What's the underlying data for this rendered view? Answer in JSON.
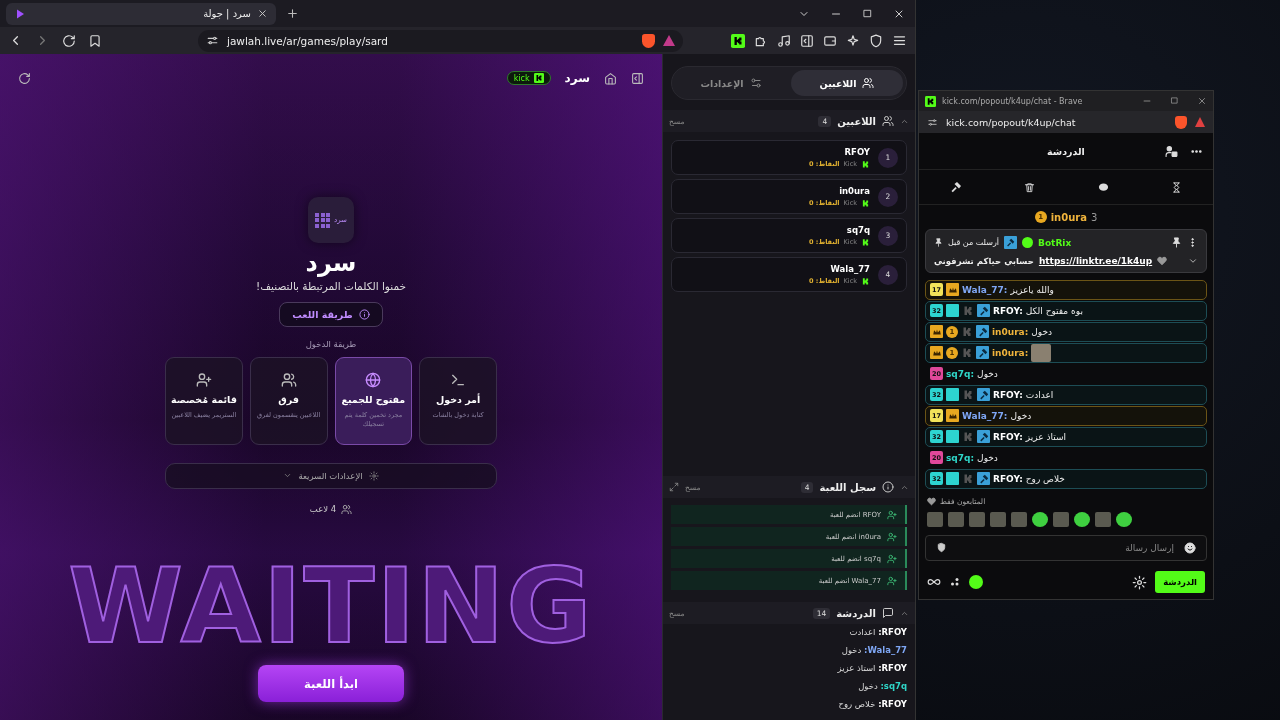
{
  "browser": {
    "tab_title": "سرد | جولة",
    "url": "jawlah.live/ar/games/play/sard"
  },
  "game": {
    "channel_badge": "kick",
    "game_name": "سرد",
    "logo_text": "سرد",
    "title": "سرد",
    "subtitle": "خمنوا الكلمات المرتبطة بالتصنيف!",
    "how_to_play": "طريقة اللعب",
    "entry_label": "طريقة الدخول",
    "entry_modes": [
      {
        "kind": "command",
        "title": "أمر دخول",
        "description": "كتابة دخول بالشات",
        "selected": false
      },
      {
        "kind": "open",
        "title": "مفتوح للجميع",
        "description": "مجرد تخمين كلمة يتم تسجيلك",
        "selected": true
      },
      {
        "kind": "teams",
        "title": "فرق",
        "description": "اللاعبين ينقسمون لفرق",
        "selected": false
      },
      {
        "kind": "custom",
        "title": "قائمة مُخصصة",
        "description": "الستريمر يضيف اللاعبين",
        "selected": false
      }
    ],
    "quick_settings": "الإعدادات السريعة",
    "player_count": "4 لاعب",
    "background_text": "WAITING",
    "start_button": "ابدأ اللعبة"
  },
  "side_panel": {
    "tabs": [
      {
        "label": "اللاعبين",
        "selected": true
      },
      {
        "label": "الإعدادات",
        "selected": false
      }
    ],
    "players": {
      "title": "اللاعبين",
      "count": "4",
      "clear": "مسح",
      "items": [
        {
          "rank": "1",
          "name": "RFOY",
          "platform": "Kick",
          "points": "النقاط: 0"
        },
        {
          "rank": "2",
          "name": "in0ura",
          "platform": "Kick",
          "points": "النقاط: 0"
        },
        {
          "rank": "3",
          "name": "sq7q",
          "platform": "Kick",
          "points": "النقاط: 0"
        },
        {
          "rank": "4",
          "name": "Wala_77",
          "platform": "Kick",
          "points": "النقاط: 0"
        }
      ]
    },
    "log": {
      "title": "سجل اللعبة",
      "count": "4",
      "clear": "مسح",
      "items": [
        "RFOY انضم للعبة",
        "in0ura انضم للعبة",
        "sq7q انضم للعبة",
        "Wala_77 انضم للعبة"
      ]
    },
    "chat": {
      "title": "الدردشة",
      "count": "14",
      "clear": "مسح",
      "messages": [
        {
          "user": "RFOY:",
          "color": "#ffffff",
          "text": "اعدادت"
        },
        {
          "user": "Wala_77:",
          "color": "#7fa7f5",
          "text": "دخول"
        },
        {
          "user": "RFOY:",
          "color": "#ffffff",
          "text": "استاذ عزيز"
        },
        {
          "user": "sq7q:",
          "color": "#2fd6c8",
          "text": "دخول"
        },
        {
          "user": "RFOY:",
          "color": "#ffffff",
          "text": "خلاص روح"
        }
      ]
    }
  },
  "kick_popup": {
    "window_title": "kick.com/popout/k4up/chat - Brave",
    "url": "kick.com/popout/k4up/chat",
    "header": "الدردشة",
    "leader": {
      "rank": "1",
      "name": "in0ura",
      "count": "3"
    },
    "pinned": {
      "author": "BotRix",
      "label": "أرسلت من قبل",
      "text": "حسابي حياكم تشرفوني",
      "link": "https://linktr.ee/1k4up"
    },
    "messages": [
      {
        "kind": "vip",
        "badges": [
          {
            "kind": "sub",
            "text": "17",
            "color": "#f2e35a"
          },
          {
            "kind": "crown"
          }
        ],
        "user": "Wala_77:",
        "color": "#7fa7f5",
        "text": "والله ياعزيز"
      },
      {
        "kind": "mod",
        "badges": [
          {
            "kind": "sub",
            "text": "32",
            "color": "#2dd4d0"
          },
          {
            "kind": "og"
          },
          {
            "kind": "kick"
          },
          {
            "kind": "mod"
          }
        ],
        "user": "RFOY:",
        "color": "#ffffff",
        "text": "بوه مفتوح الكل"
      },
      {
        "kind": "mod",
        "badges": [
          {
            "kind": "crown"
          },
          {
            "kind": "coin",
            "text": "1"
          },
          {
            "kind": "kick"
          },
          {
            "kind": "mod"
          }
        ],
        "user": "in0ura:",
        "color": "#f0b43c",
        "text": "دخول"
      },
      {
        "kind": "mod",
        "badges": [
          {
            "kind": "crown"
          },
          {
            "kind": "coin",
            "text": "1"
          },
          {
            "kind": "kick"
          },
          {
            "kind": "mod"
          }
        ],
        "user": "in0ura:",
        "color": "#f0b43c",
        "emote": true
      },
      {
        "kind": "plain",
        "badges": [
          {
            "kind": "sub",
            "text": "20",
            "color": "#e0489a"
          }
        ],
        "user": "sq7q:",
        "color": "#2fd6c8",
        "text": "دخول"
      },
      {
        "kind": "mod",
        "badges": [
          {
            "kind": "sub",
            "text": "32",
            "color": "#2dd4d0"
          },
          {
            "kind": "og"
          },
          {
            "kind": "kick"
          },
          {
            "kind": "mod"
          }
        ],
        "user": "RFOY:",
        "color": "#ffffff",
        "text": "اعدادت"
      },
      {
        "kind": "vip",
        "badges": [
          {
            "kind": "sub",
            "text": "17",
            "color": "#f2e35a"
          },
          {
            "kind": "crown"
          }
        ],
        "user": "Wala_77:",
        "color": "#7fa7f5",
        "text": "دخول"
      },
      {
        "kind": "mod",
        "badges": [
          {
            "kind": "sub",
            "text": "32",
            "color": "#2dd4d0"
          },
          {
            "kind": "og"
          },
          {
            "kind": "kick"
          },
          {
            "kind": "mod"
          }
        ],
        "user": "RFOY:",
        "color": "#ffffff",
        "text": "استاذ عزيز"
      },
      {
        "kind": "plain",
        "badges": [
          {
            "kind": "sub",
            "text": "20",
            "color": "#e0489a"
          }
        ],
        "user": "sq7q:",
        "color": "#2fd6c8",
        "text": "دخول"
      },
      {
        "kind": "mod",
        "badges": [
          {
            "kind": "sub",
            "text": "32",
            "color": "#2dd4d0"
          },
          {
            "kind": "og"
          },
          {
            "kind": "kick"
          },
          {
            "kind": "mod"
          }
        ],
        "user": "RFOY:",
        "color": "#ffffff",
        "text": "خلاص روح"
      }
    ],
    "followers_only": "المتابعون فقط",
    "input_placeholder": "إرسال رسالة",
    "chat_button": "الدردشة"
  }
}
